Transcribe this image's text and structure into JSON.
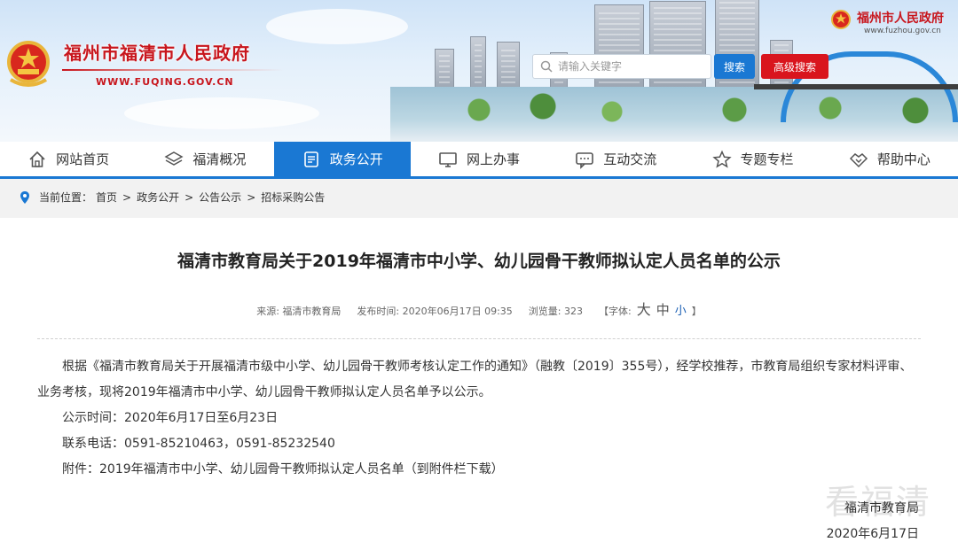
{
  "header": {
    "site_title": "福州市福清市人民政府",
    "site_url": "WWW.FUQING.GOV.CN",
    "search": {
      "placeholder": "请输入关键字",
      "button": "搜索",
      "advanced": "高级搜索"
    },
    "parent_site": {
      "title": "福州市人民政府",
      "url": "www.fuzhou.gov.cn"
    }
  },
  "nav": {
    "items": [
      {
        "label": "网站首页",
        "icon": "home-icon"
      },
      {
        "label": "福清概况",
        "icon": "layers-icon"
      },
      {
        "label": "政务公开",
        "icon": "document-icon",
        "active": true
      },
      {
        "label": "网上办事",
        "icon": "monitor-icon"
      },
      {
        "label": "互动交流",
        "icon": "chat-icon"
      },
      {
        "label": "专题专栏",
        "icon": "star-icon"
      },
      {
        "label": "帮助中心",
        "icon": "handshake-icon"
      }
    ]
  },
  "breadcrumb": {
    "prefix": "当前位置：",
    "items": [
      "首页",
      "政务公开",
      "公告公示",
      "招标采购公告"
    ]
  },
  "article": {
    "title": "福清市教育局关于2019年福清市中小学、幼儿园骨干教师拟认定人员名单的公示",
    "meta": {
      "source": "来源: 福清市教育局",
      "published": "发布时间: 2020年06月17日 09:35",
      "views": "浏览量: 323",
      "font_label": "【字体:",
      "font_big": "大",
      "font_mid": "中",
      "font_small": "小",
      "font_close": "】"
    },
    "paragraphs": [
      "根据《福清市教育局关于开展福清市级中小学、幼儿园骨干教师考核认定工作的通知》（融教〔2019〕355号），经学校推荐，市教育局组织专家材料评审、业务考核，现将2019年福清市中小学、幼儿园骨干教师拟认定人员名单予以公示。",
      "公示时间：2020年6月17日至6月23日",
      "联系电话：0591-85210463，0591-85232540",
      "附件：2019年福清市中小学、幼儿园骨干教师拟认定人员名单（到附件栏下载）"
    ],
    "signature": {
      "org": "福清市教育局",
      "date": "2020年6月17日"
    },
    "watermark": "看福清"
  },
  "colors": {
    "brand_red": "#c8161d",
    "nav_blue": "#1a78d3",
    "adv_red": "#d9151d"
  }
}
